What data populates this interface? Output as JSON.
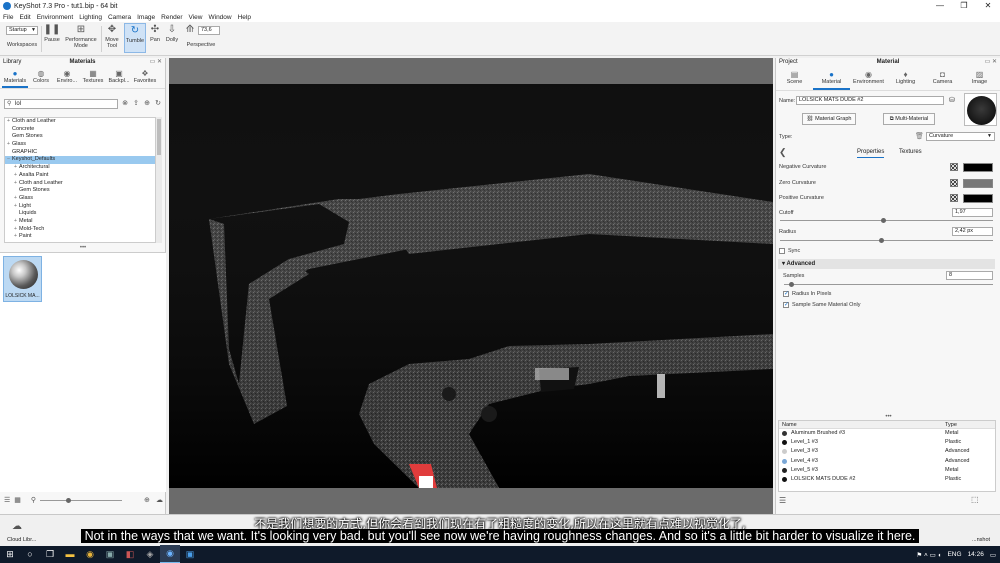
{
  "window": {
    "title": "KeyShot 7.3 Pro  -  tut1.bip  -  64 bit",
    "controls": [
      "—",
      "❐",
      "✕"
    ]
  },
  "menu": [
    "File",
    "Edit",
    "Environment",
    "Lighting",
    "Camera",
    "Image",
    "Render",
    "View",
    "Window",
    "Help"
  ],
  "toolbar": {
    "workspace_value": "Startup",
    "workspaces_label": "Workspaces",
    "pause_label": "Pause",
    "performance_label": "Performance Mode",
    "move_tool_label": "Move Tool",
    "tumble_label": "Tumble",
    "pan_label": "Pan",
    "dolly_label": "Dolly",
    "zoom_value": "73,6",
    "perspective_label": "Perspective"
  },
  "library": {
    "panel_left": "Library",
    "panel_title": "Materials",
    "tabs": [
      "Materials",
      "Colors",
      "Enviro...",
      "Textures",
      "Backpl...",
      "Favorites"
    ],
    "search_value": "lol",
    "tree": [
      {
        "label": "Cloth and Leather",
        "level": 0,
        "toggle": "+"
      },
      {
        "label": "Concrete",
        "level": 0,
        "toggle": ""
      },
      {
        "label": "Gem Stones",
        "level": 0,
        "toggle": ""
      },
      {
        "label": "Glass",
        "level": 0,
        "toggle": "+"
      },
      {
        "label": "GRAPHIC",
        "level": 0,
        "toggle": ""
      },
      {
        "label": "Keyshot_Defaults",
        "level": 0,
        "toggle": "−",
        "selected": true
      },
      {
        "label": "Architectural",
        "level": 1,
        "toggle": "+"
      },
      {
        "label": "Axalta Paint",
        "level": 1,
        "toggle": "+"
      },
      {
        "label": "Cloth and Leather",
        "level": 1,
        "toggle": "+"
      },
      {
        "label": "Gem Stones",
        "level": 1,
        "toggle": ""
      },
      {
        "label": "Glass",
        "level": 1,
        "toggle": "+"
      },
      {
        "label": "Light",
        "level": 1,
        "toggle": "+"
      },
      {
        "label": "Liquids",
        "level": 1,
        "toggle": ""
      },
      {
        "label": "Metal",
        "level": 1,
        "toggle": "+"
      },
      {
        "label": "Mold-Tech",
        "level": 1,
        "toggle": "+"
      },
      {
        "label": "Paint",
        "level": 1,
        "toggle": "+"
      }
    ],
    "thumbnail_label": "LOLSICK MA..."
  },
  "right": {
    "panel_left": "Project",
    "panel_title": "Material",
    "tabs": [
      "Scene",
      "Material",
      "Environment",
      "Lighting",
      "Camera",
      "Image"
    ],
    "name_label": "Name:",
    "name_value": "LOLSICK MATS DUDE #2",
    "material_graph_label": "Material Graph",
    "multi_material_label": "Multi-Material",
    "type_label": "Type:",
    "type_value": "Curvature",
    "subtab_properties": "Properties",
    "subtab_textures": "Textures",
    "negative_curvature_label": "Negative Curvature",
    "zero_curvature_label": "Zero Curvature",
    "positive_curvature_label": "Positive Curvature",
    "cutoff_label": "Cutoff",
    "cutoff_value": "1,97",
    "radius_label": "Radius",
    "radius_value": "2,42 px",
    "sync_label": "Sync",
    "advanced_label": "Advanced",
    "samples_label": "Samples",
    "samples_value": "8",
    "radius_in_pixels_label": "Radius In Pixels",
    "sample_same_label": "Sample Same Material Only",
    "colors": {
      "negative": "#000000",
      "zero": "#777777",
      "positive": "#000000"
    },
    "list_header_name": "Name",
    "list_header_type": "Type",
    "materials": [
      {
        "name": "Aluminum Brushed #3",
        "type": "Metal",
        "color": "#333333"
      },
      {
        "name": "Level_1 #3",
        "type": "Plastic",
        "color": "#111111"
      },
      {
        "name": "Level_3 #3",
        "type": "Advanced",
        "color": "#cccccc"
      },
      {
        "name": "Level_4 #3",
        "type": "Advanced",
        "color": "#7aa7d6"
      },
      {
        "name": "Level_5 #3",
        "type": "Metal",
        "color": "#222222"
      },
      {
        "name": "LOLSICK MATS DUDE #2",
        "type": "Plastic",
        "color": "#111111"
      }
    ]
  },
  "bottom": {
    "left_label": "Cloud Libr...",
    "right_label": "...nshot"
  },
  "subtitles": {
    "zh": "不是我们想要的方式,但你会看到我们现在有了粗糙度的变化,所以在这里就有点难以视觉化了,",
    "en": "Not in the ways that we want. It's looking very bad. but you'll see now we're having roughness changes. And so it's a little bit harder to visualize it here."
  },
  "taskbar": {
    "language": "ENG",
    "time": "14:26"
  }
}
